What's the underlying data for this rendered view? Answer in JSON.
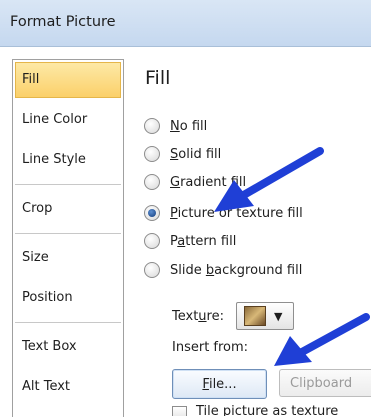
{
  "window": {
    "title": "Format Picture"
  },
  "sidebar": {
    "items": [
      {
        "label": "Fill",
        "selected": true
      },
      {
        "label": "Line Color"
      },
      {
        "label": "Line Style"
      },
      {
        "label": "Crop"
      },
      {
        "label": "Size"
      },
      {
        "label": "Position"
      },
      {
        "label": "Text Box"
      },
      {
        "label": "Alt Text"
      }
    ]
  },
  "main": {
    "heading": "Fill",
    "fill_options": [
      {
        "pre": "",
        "key": "N",
        "post": "o fill",
        "checked": false
      },
      {
        "pre": "",
        "key": "S",
        "post": "olid fill",
        "checked": false
      },
      {
        "pre": "",
        "key": "G",
        "post": "radient fill",
        "checked": false
      },
      {
        "pre": "",
        "key": "P",
        "post": "icture or texture fill",
        "checked": true
      },
      {
        "pre": "P",
        "key": "a",
        "post": "ttern fill",
        "checked": false
      },
      {
        "pre": "Slide ",
        "key": "b",
        "post": "ackground fill",
        "checked": false
      }
    ],
    "texture": {
      "pre": "Text",
      "key": "u",
      "post": "re:",
      "icon": "texture-swatch-icon",
      "dropdown_icon": "caret-down-icon"
    },
    "insert_from_label": "Insert from:",
    "file_button": {
      "key": "F",
      "post": "ile..."
    },
    "clipboard_button": {
      "label": "Clipboard"
    },
    "tile_checkbox": {
      "label": "Tile picture as texture"
    }
  },
  "colors": {
    "arrow": "#1f3fd6",
    "selected_bg": "#fbd06a",
    "titlebar": "#c5d8ef"
  }
}
